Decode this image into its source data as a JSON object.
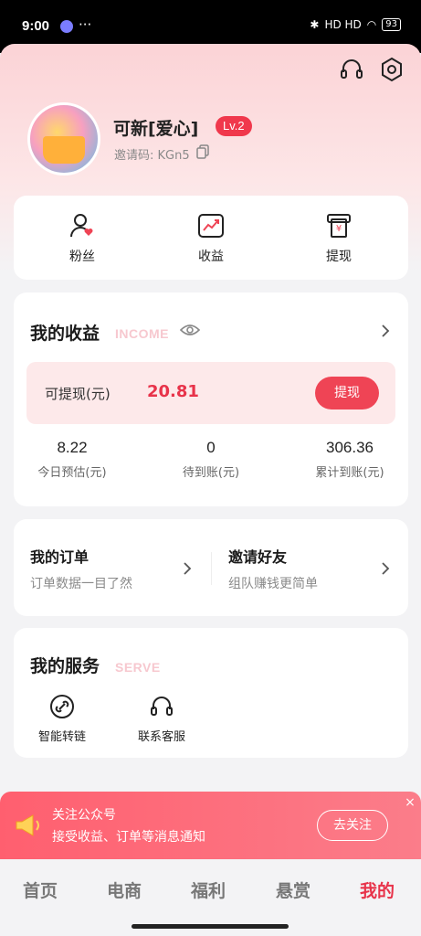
{
  "status_bar": {
    "time": "9:00",
    "more": "···",
    "signal": "HD HD",
    "battery": "93"
  },
  "profile": {
    "name": "可新[爱心]",
    "level": "Lv.2",
    "invite_code": "邀请码: KGn5"
  },
  "quick_actions": [
    {
      "label": "粉丝",
      "icon": "fans-icon"
    },
    {
      "label": "收益",
      "icon": "earnings-icon"
    },
    {
      "label": "提现",
      "icon": "withdraw-icon"
    }
  ],
  "income": {
    "title": "我的收益",
    "subtitle": "INCOME",
    "withdrawable_label": "可提现(元)",
    "withdrawable_value": "20.81",
    "withdraw_button": "提现",
    "stats": [
      {
        "value": "8.22",
        "caption": "今日预估(元)"
      },
      {
        "value": "0",
        "caption": "待到账(元)"
      },
      {
        "value": "306.36",
        "caption": "累计到账(元)"
      }
    ]
  },
  "orders": {
    "my_orders": {
      "title": "我的订单",
      "subtitle": "订单数据一目了然"
    },
    "invite_friends": {
      "title": "邀请好友",
      "subtitle": "组队赚钱更简单"
    }
  },
  "services": {
    "title": "我的服务",
    "subtitle": "SERVE",
    "items": [
      {
        "label": "智能转链",
        "icon": "link-icon"
      },
      {
        "label": "联系客服",
        "icon": "headset-icon"
      }
    ]
  },
  "banner": {
    "title": "关注公众号",
    "desc": "接受收益、订单等消息通知",
    "button": "去关注",
    "close": "×"
  },
  "tabs": [
    {
      "label": "首页"
    },
    {
      "label": "电商"
    },
    {
      "label": "福利"
    },
    {
      "label": "悬赏"
    },
    {
      "label": "我的",
      "active": true
    }
  ],
  "colors": {
    "accent": "#ef4455",
    "header_pink": "#fbd3d6"
  }
}
